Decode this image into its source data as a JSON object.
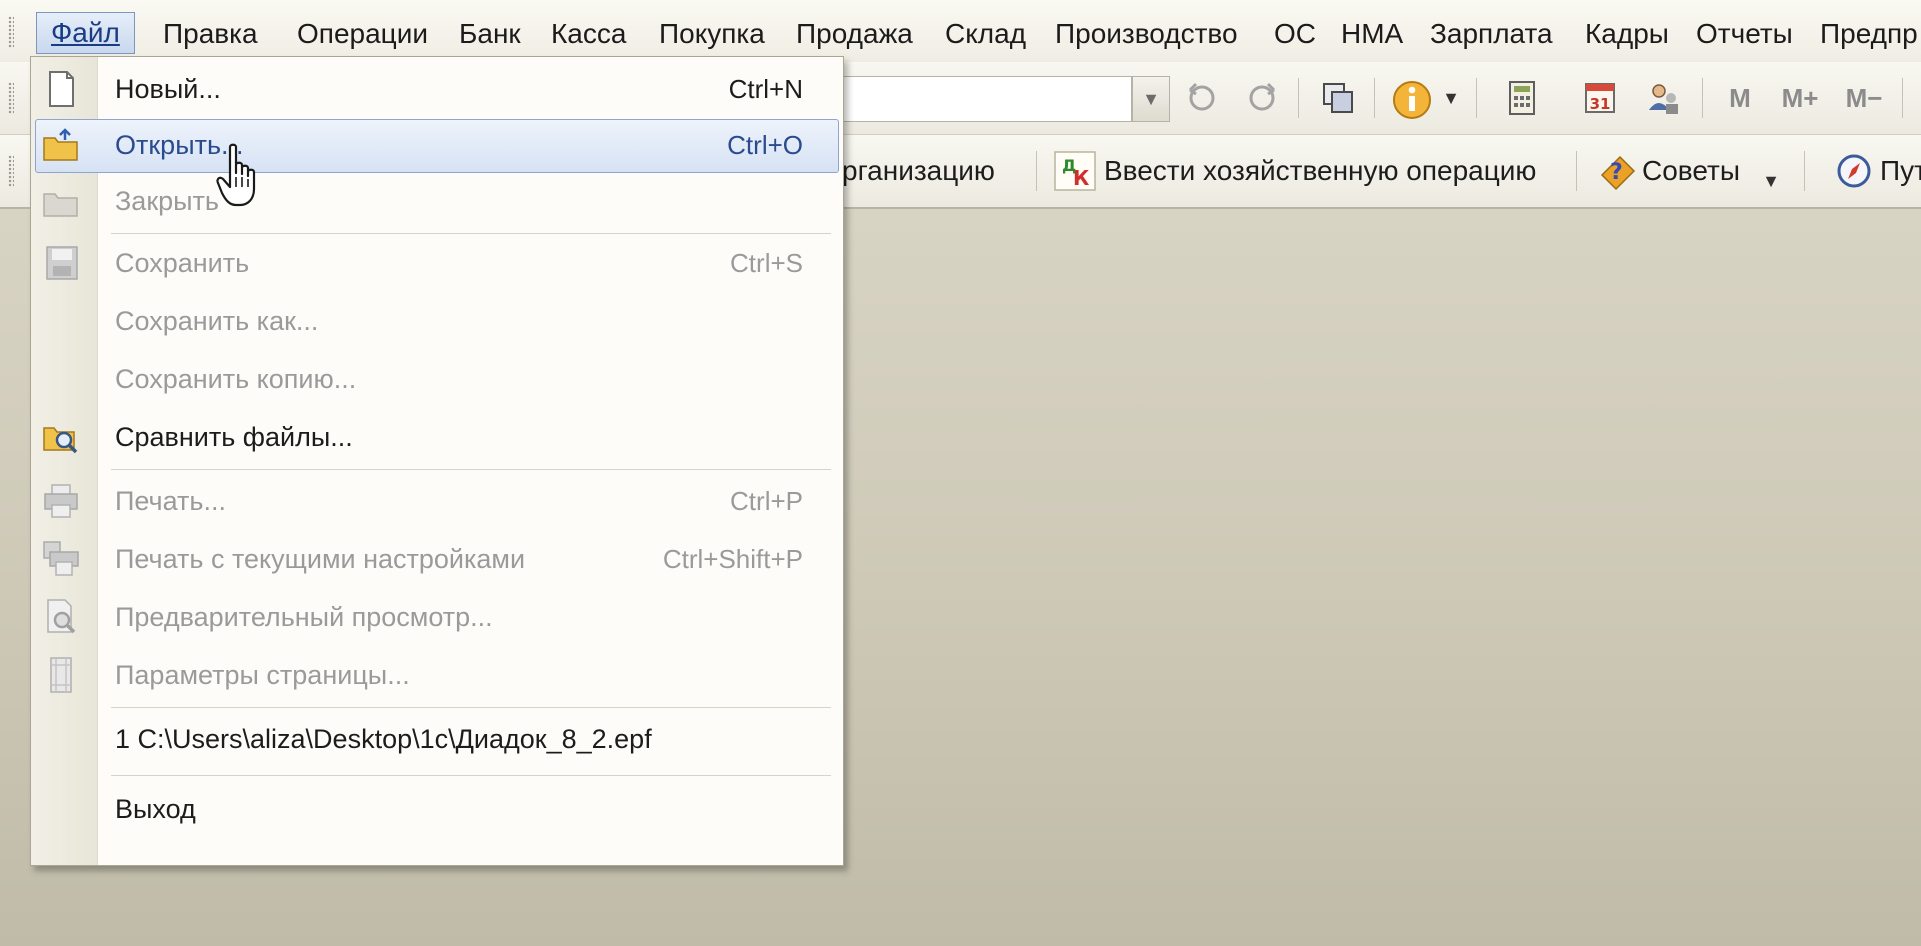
{
  "menubar": {
    "items": [
      "Файл",
      "Правка",
      "Операции",
      "Банк",
      "Касса",
      "Покупка",
      "Продажа",
      "Склад",
      "Производство",
      "ОС",
      "НМА",
      "Зарплата",
      "Кадры",
      "Отчеты",
      "Предпр"
    ],
    "active_index": 0
  },
  "toolbar1": {
    "buttons": [
      "M",
      "M+",
      "M−"
    ]
  },
  "toolbar2": {
    "org_partial": "рганизацию",
    "enter_operation": "Ввести хозяйственную операцию",
    "tips": "Советы",
    "path_partial": "Пут"
  },
  "file_menu": {
    "items": [
      {
        "label": "Новый...",
        "shortcut": "Ctrl+N",
        "enabled": true,
        "icon": "new-document-icon"
      },
      {
        "label": "Открыть...",
        "shortcut": "Ctrl+O",
        "enabled": true,
        "icon": "open-folder-icon",
        "highlighted": true
      },
      {
        "label": "Закрыть",
        "shortcut": "",
        "enabled": false,
        "icon": "close-folder-icon"
      },
      {
        "label": "Сохранить",
        "shortcut": "Ctrl+S",
        "enabled": false,
        "icon": "save-icon"
      },
      {
        "label": "Сохранить как...",
        "shortcut": "",
        "enabled": false,
        "icon": ""
      },
      {
        "label": "Сохранить копию...",
        "shortcut": "",
        "enabled": false,
        "icon": ""
      },
      {
        "label": "Сравнить файлы...",
        "shortcut": "",
        "enabled": true,
        "icon": "compare-files-icon"
      },
      {
        "label": "Печать...",
        "shortcut": "Ctrl+P",
        "enabled": false,
        "icon": "printer-icon"
      },
      {
        "label": "Печать с текущими настройками",
        "shortcut": "Ctrl+Shift+P",
        "enabled": false,
        "icon": "quick-print-icon"
      },
      {
        "label": "Предварительный просмотр...",
        "shortcut": "",
        "enabled": false,
        "icon": "print-preview-icon"
      },
      {
        "label": "Параметры страницы...",
        "shortcut": "",
        "enabled": false,
        "icon": "page-setup-icon"
      },
      {
        "label": "1 C:\\Users\\aliza\\Desktop\\1c\\Диадок_8_2.epf",
        "shortcut": "",
        "enabled": true,
        "icon": ""
      },
      {
        "label": "Выход",
        "shortcut": "",
        "enabled": true,
        "icon": ""
      }
    ]
  },
  "colors": {
    "highlight_border": "#8ea6cf",
    "disabled_text": "#9a9a9a",
    "desktop": "#cdc8b6"
  }
}
